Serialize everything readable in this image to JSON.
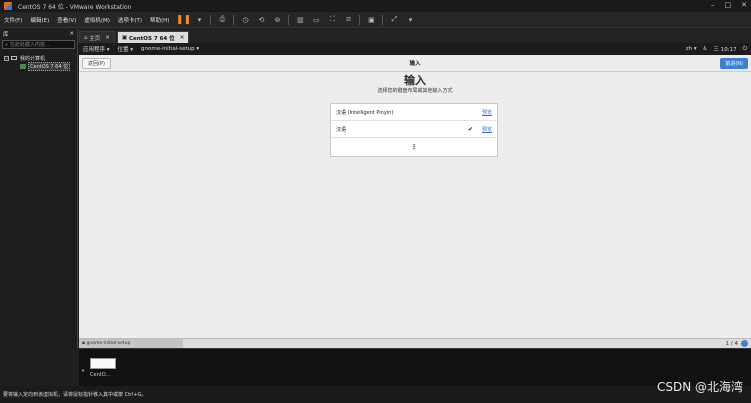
{
  "window": {
    "title": "CentOS 7 64 位 - VMware Workstation",
    "controls": [
      "–",
      "□",
      "✕"
    ]
  },
  "menu": [
    "文件(F)",
    "编辑(E)",
    "查看(V)",
    "虚拟机(M)",
    "选项卡(T)",
    "帮助(H)"
  ],
  "library": {
    "title": "库",
    "close": "✕",
    "search_placeholder": "在此处键入内容...",
    "tree": {
      "root": "我的计算机",
      "child": "CentOS 7 64 位"
    }
  },
  "tabs": [
    {
      "label": "主页",
      "close": "✕"
    },
    {
      "label": "CentOS 7 64 位",
      "close": "✕"
    }
  ],
  "gnome": {
    "apps": "应用程序 ▾",
    "places": "位置 ▾",
    "current_app": "gnome-initial-setup ▾",
    "lang": "zh ▾",
    "time": "三 10:17"
  },
  "setup": {
    "back_label": "返回(P)",
    "header_title": "输入",
    "next_label": "前进(N)",
    "title": "输入",
    "subtitle": "选择您的键盘布局或其他输入方式",
    "options": [
      {
        "name": "汉语 (Intelligent Pinyin)",
        "selected": false,
        "preview": "预览"
      },
      {
        "name": "汉语",
        "selected": true,
        "preview": "预览"
      }
    ],
    "more": "⋮"
  },
  "taskbar": {
    "task": "gnome-initial-setup",
    "pager": "1 / 4"
  },
  "thumbnail": {
    "caption": "CentO..."
  },
  "status": "要将输入定向到该虚拟机，请将鼠标指针移入其中或按 Ctrl+G。",
  "watermark": "CSDN @北海湾",
  "colors": {
    "accent": "#3d7fd5",
    "pause": "#f08a24"
  }
}
